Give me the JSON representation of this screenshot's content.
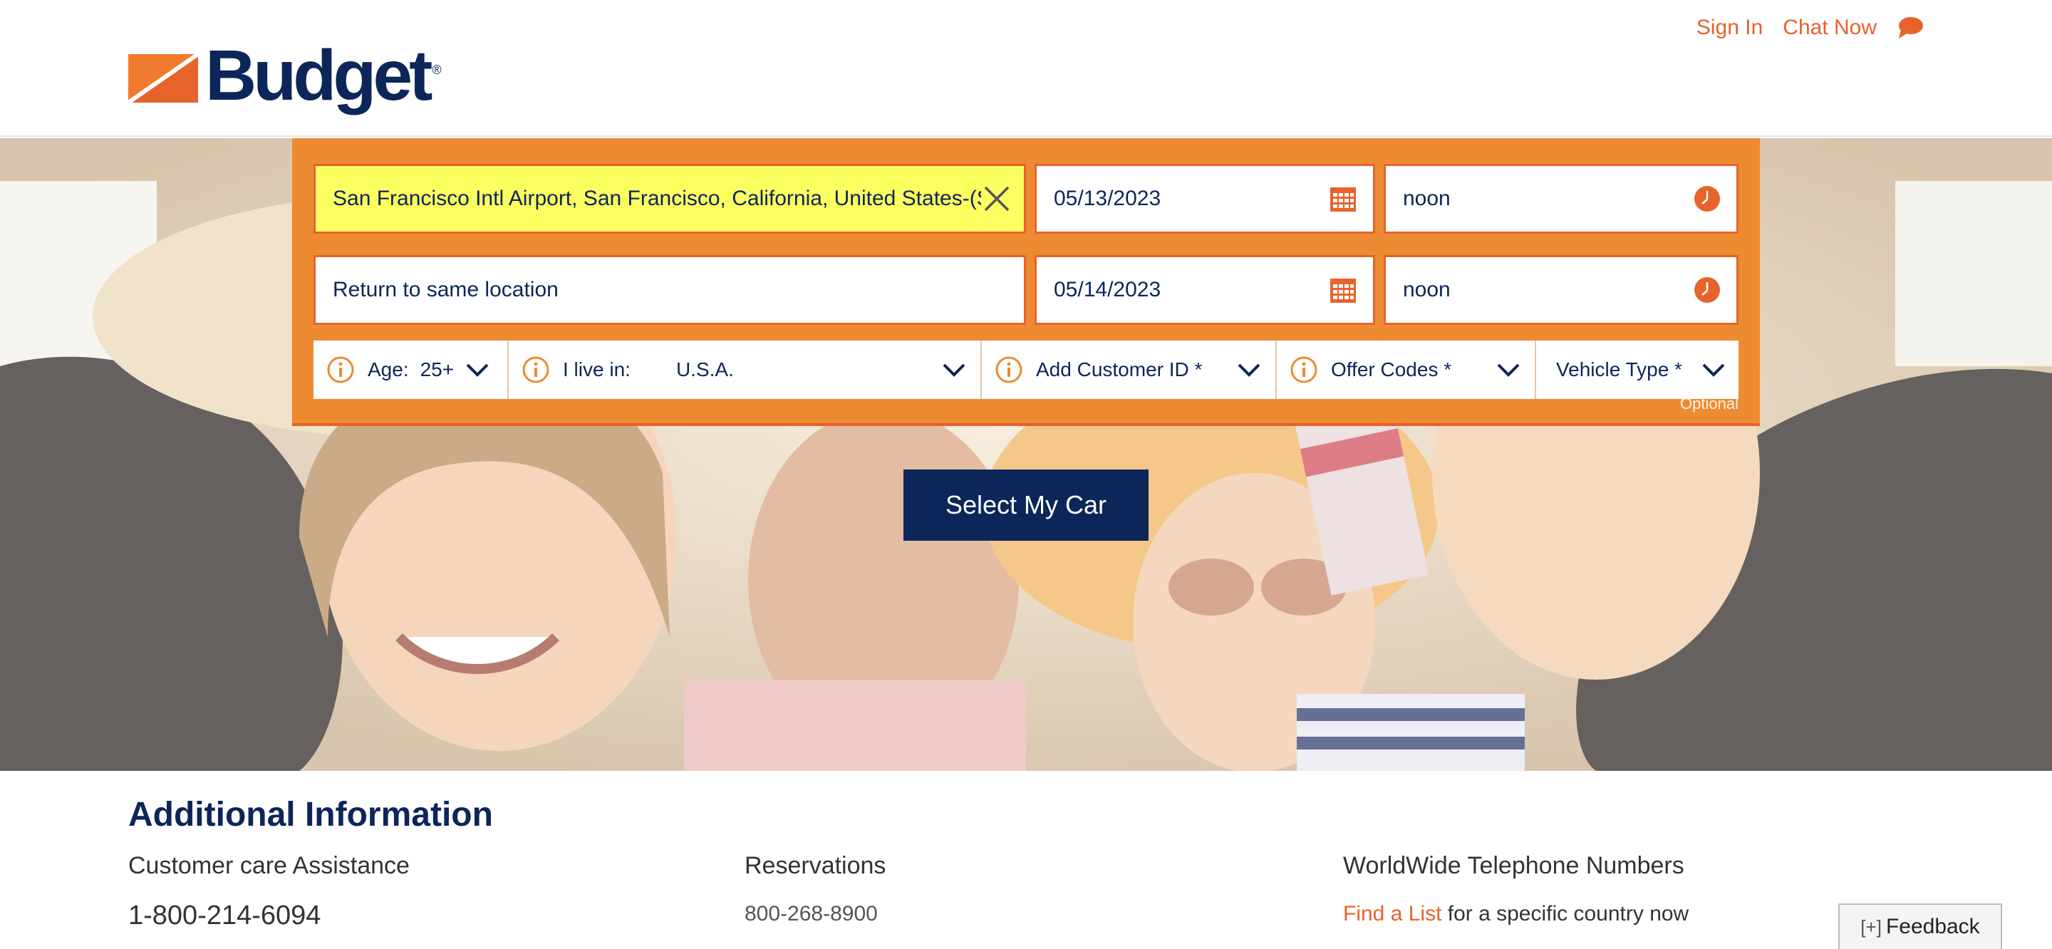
{
  "header": {
    "logo_text": "Budget",
    "logo_reg": "®",
    "sign_in": "Sign In",
    "chat_now": "Chat Now",
    "icons": {
      "chat": "chat-bubble-icon"
    }
  },
  "booking": {
    "pickup_location": "San Francisco Intl Airport, San Francisco, California, United States-(SFO)",
    "pickup_date": "05/13/2023",
    "pickup_time": "noon",
    "return_location": "Return to same location",
    "return_date": "05/14/2023",
    "return_time": "noon",
    "age_label": "Age:",
    "age_value": "25+",
    "live_label": "I live in:",
    "live_value": "U.S.A.",
    "customer_id": "Add Customer ID *",
    "offer_codes": "Offer Codes *",
    "vehicle_type": "Vehicle Type *",
    "optional": "Optional",
    "submit": "Select My Car"
  },
  "additional": {
    "title": "Additional Information",
    "care_heading": "Customer care Assistance",
    "care_phone": "1-800-214-6094",
    "res_heading": "Reservations",
    "res_phone": "800-268-8900",
    "ww_heading": "WorldWide Telephone Numbers",
    "ww_link": "Find a List",
    "ww_suffix": " for a specific country now"
  },
  "feedback": {
    "plus": "[+]",
    "label": "Feedback"
  },
  "colors": {
    "brand_orange": "#e8622c",
    "panel_orange": "#ed8b32",
    "navy": "#0c2659",
    "highlight_yellow": "#fcff60"
  }
}
